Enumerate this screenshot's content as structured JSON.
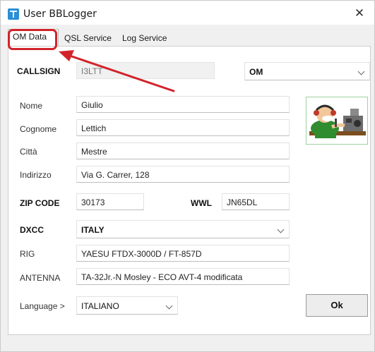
{
  "window": {
    "title": "User BBLogger",
    "close_glyph": "✕",
    "app_icon": "bblogger-app-icon"
  },
  "tabs": [
    {
      "label": "OM Data",
      "active": true
    },
    {
      "label": "QSL Service",
      "active": false
    },
    {
      "label": "Log Service",
      "active": false
    }
  ],
  "annotation": {
    "color": "#d2232a"
  },
  "form": {
    "callsign_label": "CALLSIGN",
    "callsign_value": "I3LTT",
    "type_value": "OM",
    "nome_label": "Nome",
    "nome_value": "Giulio",
    "cognome_label": "Cognome",
    "cognome_value": "Lettich",
    "citta_label": "Città",
    "citta_value": "Mestre",
    "indirizzo_label": "Indirizzo",
    "indirizzo_value": "Via G. Carrer, 128",
    "zip_label": "ZIP CODE",
    "zip_value": "30173",
    "wwl_label": "WWL",
    "wwl_value": "JN65DL",
    "dxcc_label": "DXCC",
    "dxcc_value": "ITALY",
    "rig_label": "RIG",
    "rig_value": "YAESU  FTDX-3000D / FT-857D",
    "antenna_label": "ANTENNA",
    "antenna_value": "TA-32Jr.-N Mosley - ECO AVT-4 modificata",
    "language_label": "Language >",
    "language_value": "ITALIANO",
    "ok_label": "Ok"
  },
  "avatar": {
    "icon": "radio-operator-cartoon-icon"
  }
}
